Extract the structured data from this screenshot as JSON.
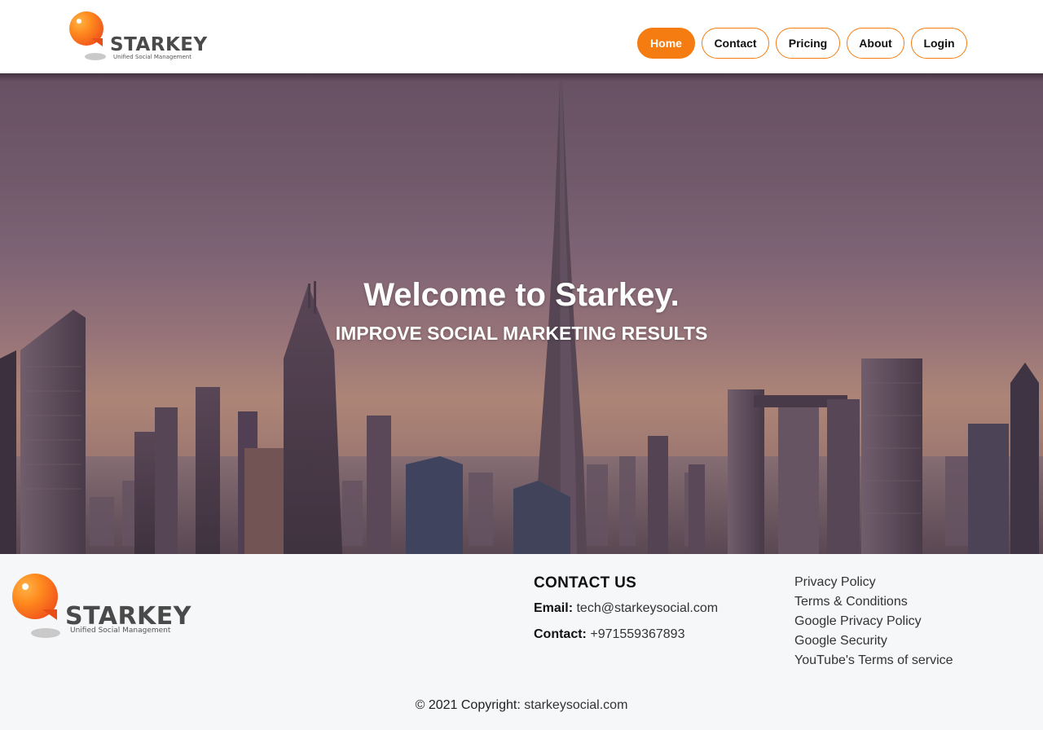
{
  "brand": {
    "name": "STARKEY",
    "tagline": "Unified Social Management",
    "accent": "#f47c10"
  },
  "nav": {
    "items": [
      {
        "label": "Home",
        "active": true
      },
      {
        "label": "Contact",
        "active": false
      },
      {
        "label": "Pricing",
        "active": false
      },
      {
        "label": "About",
        "active": false
      },
      {
        "label": "Login",
        "active": false
      }
    ]
  },
  "hero": {
    "title": "Welcome to Starkey.",
    "subtitle": "IMPROVE SOCIAL MARKETING RESULTS",
    "background": "city-skyline-image"
  },
  "footer": {
    "contact": {
      "heading": "CONTACT US",
      "email_label": "Email:",
      "email_value": "tech@starkeysocial.com",
      "phone_label": "Contact:",
      "phone_value": "+971559367893"
    },
    "links": [
      "Privacy Policy",
      "Terms & Conditions",
      "Google Privacy Policy",
      "Google Security",
      "YouTube's Terms of service"
    ],
    "copyright_prefix": "© 2021 Copyright:",
    "copyright_link": "starkeysocial.com"
  }
}
